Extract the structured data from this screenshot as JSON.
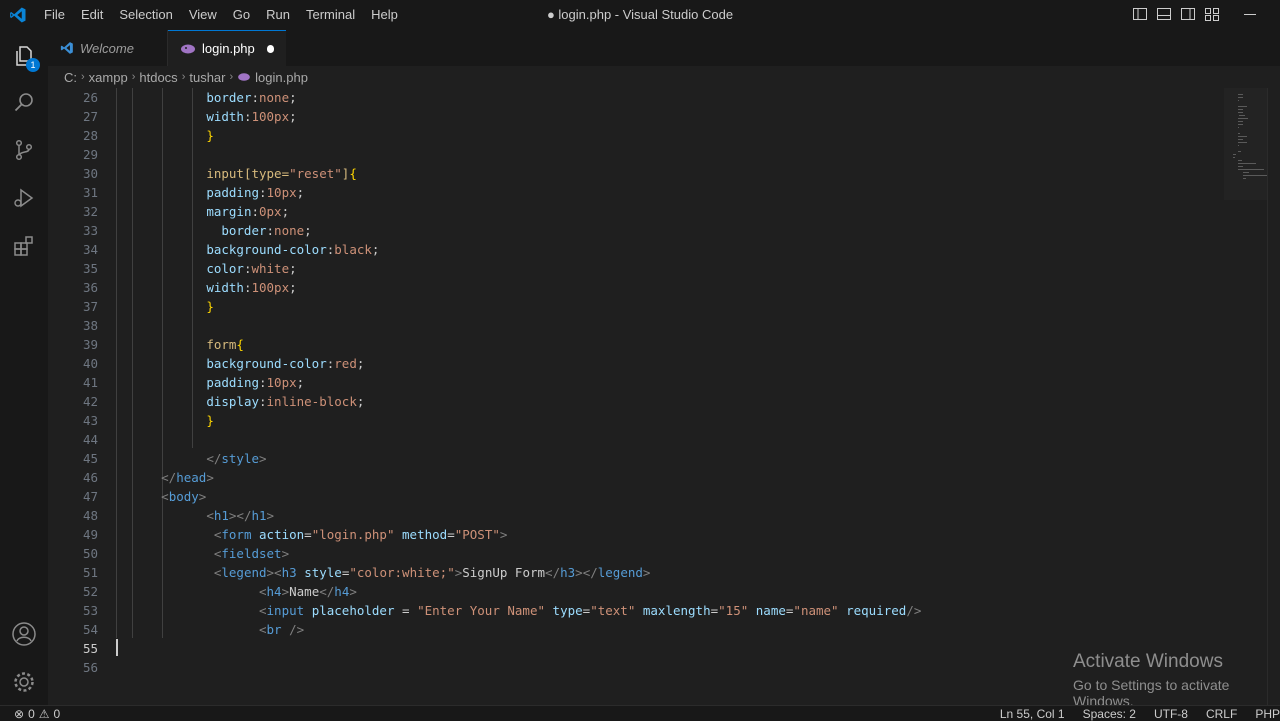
{
  "titlebar": {
    "menu": [
      "File",
      "Edit",
      "Selection",
      "View",
      "Go",
      "Run",
      "Terminal",
      "Help"
    ],
    "window_title": "● login.php - Visual Studio Code"
  },
  "activity": {
    "explorer_badge": "1",
    "icons": [
      "files-icon",
      "search-icon",
      "source-control-icon",
      "run-debug-icon",
      "extensions-icon",
      "account-icon",
      "settings-gear-icon"
    ]
  },
  "tabs": [
    {
      "label": "Welcome",
      "active": false
    },
    {
      "label": "login.php",
      "active": true,
      "modified": true
    }
  ],
  "breadcrumb": [
    "C:",
    "xampp",
    "htdocs",
    "tushar",
    "login.php"
  ],
  "editor": {
    "cursor_line": 55,
    "lines": [
      {
        "n": "26",
        "indent": "            ",
        "tokens": [
          [
            "prop",
            "border"
          ],
          [
            "punc",
            ":"
          ],
          [
            "val",
            "none"
          ],
          [
            "punc",
            ";"
          ]
        ]
      },
      {
        "n": "27",
        "indent": "            ",
        "tokens": [
          [
            "prop",
            "width"
          ],
          [
            "punc",
            ":"
          ],
          [
            "val",
            "100px"
          ],
          [
            "punc",
            ";"
          ]
        ]
      },
      {
        "n": "28",
        "indent": "            ",
        "tokens": [
          [
            "brace",
            "}"
          ]
        ]
      },
      {
        "n": "29",
        "indent": "",
        "tokens": []
      },
      {
        "n": "30",
        "indent": "            ",
        "tokens": [
          [
            "sel",
            "input[type="
          ],
          [
            "val",
            "\"reset\""
          ],
          [
            "sel",
            "]"
          ],
          [
            "brace",
            "{"
          ]
        ]
      },
      {
        "n": "31",
        "indent": "            ",
        "tokens": [
          [
            "prop",
            "padding"
          ],
          [
            "punc",
            ":"
          ],
          [
            "val",
            "10px"
          ],
          [
            "punc",
            ";"
          ]
        ]
      },
      {
        "n": "32",
        "indent": "            ",
        "tokens": [
          [
            "prop",
            "margin"
          ],
          [
            "punc",
            ":"
          ],
          [
            "val",
            "0px"
          ],
          [
            "punc",
            ";"
          ]
        ]
      },
      {
        "n": "33",
        "indent": "              ",
        "tokens": [
          [
            "prop",
            "border"
          ],
          [
            "punc",
            ":"
          ],
          [
            "val",
            "none"
          ],
          [
            "punc",
            ";"
          ]
        ]
      },
      {
        "n": "34",
        "indent": "            ",
        "tokens": [
          [
            "prop",
            "background-color"
          ],
          [
            "punc",
            ":"
          ],
          [
            "val",
            "black"
          ],
          [
            "punc",
            ";"
          ]
        ]
      },
      {
        "n": "35",
        "indent": "            ",
        "tokens": [
          [
            "prop",
            "color"
          ],
          [
            "punc",
            ":"
          ],
          [
            "val",
            "white"
          ],
          [
            "punc",
            ";"
          ]
        ]
      },
      {
        "n": "36",
        "indent": "            ",
        "tokens": [
          [
            "prop",
            "width"
          ],
          [
            "punc",
            ":"
          ],
          [
            "val",
            "100px"
          ],
          [
            "punc",
            ";"
          ]
        ]
      },
      {
        "n": "37",
        "indent": "            ",
        "tokens": [
          [
            "brace",
            "}"
          ]
        ]
      },
      {
        "n": "38",
        "indent": "",
        "tokens": []
      },
      {
        "n": "39",
        "indent": "            ",
        "tokens": [
          [
            "sel",
            "form"
          ],
          [
            "brace",
            "{"
          ]
        ]
      },
      {
        "n": "40",
        "indent": "            ",
        "tokens": [
          [
            "prop",
            "background-color"
          ],
          [
            "punc",
            ":"
          ],
          [
            "val",
            "red"
          ],
          [
            "punc",
            ";"
          ]
        ]
      },
      {
        "n": "41",
        "indent": "            ",
        "tokens": [
          [
            "prop",
            "padding"
          ],
          [
            "punc",
            ":"
          ],
          [
            "val",
            "10px"
          ],
          [
            "punc",
            ";"
          ]
        ]
      },
      {
        "n": "42",
        "indent": "            ",
        "tokens": [
          [
            "prop",
            "display"
          ],
          [
            "punc",
            ":"
          ],
          [
            "val",
            "inline-block"
          ],
          [
            "punc",
            ";"
          ]
        ]
      },
      {
        "n": "43",
        "indent": "            ",
        "tokens": [
          [
            "brace",
            "}"
          ]
        ]
      },
      {
        "n": "44",
        "indent": "",
        "tokens": []
      },
      {
        "n": "45",
        "indent": "            ",
        "tokens": [
          [
            "angle",
            "</"
          ],
          [
            "tag",
            "style"
          ],
          [
            "angle",
            ">"
          ]
        ]
      },
      {
        "n": "46",
        "indent": "      ",
        "tokens": [
          [
            "angle",
            "</"
          ],
          [
            "tag",
            "head"
          ],
          [
            "angle",
            ">"
          ]
        ]
      },
      {
        "n": "47",
        "indent": "      ",
        "tokens": [
          [
            "angle",
            "<"
          ],
          [
            "tag",
            "body"
          ],
          [
            "angle",
            ">"
          ]
        ]
      },
      {
        "n": "48",
        "indent": "            ",
        "tokens": [
          [
            "angle",
            "<"
          ],
          [
            "tag",
            "h1"
          ],
          [
            "angle",
            "></"
          ],
          [
            "tag",
            "h1"
          ],
          [
            "angle",
            ">"
          ]
        ]
      },
      {
        "n": "49",
        "indent": "             ",
        "tokens": [
          [
            "angle",
            "<"
          ],
          [
            "tag",
            "form"
          ],
          [
            "text",
            " "
          ],
          [
            "attr",
            "action"
          ],
          [
            "punc",
            "="
          ],
          [
            "str",
            "\"login.php\""
          ],
          [
            "text",
            " "
          ],
          [
            "attr",
            "method"
          ],
          [
            "punc",
            "="
          ],
          [
            "str",
            "\"POST\""
          ],
          [
            "angle",
            ">"
          ]
        ]
      },
      {
        "n": "50",
        "indent": "             ",
        "tokens": [
          [
            "angle",
            "<"
          ],
          [
            "tag",
            "fieldset"
          ],
          [
            "angle",
            ">"
          ]
        ]
      },
      {
        "n": "51",
        "indent": "             ",
        "tokens": [
          [
            "angle",
            "<"
          ],
          [
            "tag",
            "legend"
          ],
          [
            "angle",
            "><"
          ],
          [
            "tag",
            "h3"
          ],
          [
            "text",
            " "
          ],
          [
            "attr",
            "style"
          ],
          [
            "punc",
            "="
          ],
          [
            "str",
            "\"color:white;\""
          ],
          [
            "angle",
            ">"
          ],
          [
            "text",
            "SignUp Form"
          ],
          [
            "angle",
            "</"
          ],
          [
            "tag",
            "h3"
          ],
          [
            "angle",
            "></"
          ],
          [
            "tag",
            "legend"
          ],
          [
            "angle",
            ">"
          ]
        ]
      },
      {
        "n": "52",
        "indent": "                   ",
        "tokens": [
          [
            "angle",
            "<"
          ],
          [
            "tag",
            "h4"
          ],
          [
            "angle",
            ">"
          ],
          [
            "text",
            "Name"
          ],
          [
            "angle",
            "</"
          ],
          [
            "tag",
            "h4"
          ],
          [
            "angle",
            ">"
          ]
        ]
      },
      {
        "n": "53",
        "indent": "                   ",
        "tokens": [
          [
            "angle",
            "<"
          ],
          [
            "tag",
            "input"
          ],
          [
            "text",
            " "
          ],
          [
            "attr",
            "placeholder"
          ],
          [
            "text",
            " = "
          ],
          [
            "str",
            "\"Enter Your Name\""
          ],
          [
            "text",
            " "
          ],
          [
            "attr",
            "type"
          ],
          [
            "punc",
            "="
          ],
          [
            "str",
            "\"text\""
          ],
          [
            "text",
            " "
          ],
          [
            "attr",
            "maxlength"
          ],
          [
            "punc",
            "="
          ],
          [
            "str",
            "\"15\""
          ],
          [
            "text",
            " "
          ],
          [
            "attr",
            "name"
          ],
          [
            "punc",
            "="
          ],
          [
            "str",
            "\"name\""
          ],
          [
            "text",
            " "
          ],
          [
            "attr",
            "required"
          ],
          [
            "angle",
            "/>"
          ]
        ]
      },
      {
        "n": "54",
        "indent": "                   ",
        "tokens": [
          [
            "angle",
            "<"
          ],
          [
            "tag",
            "br"
          ],
          [
            "text",
            " "
          ],
          [
            "angle",
            "/>"
          ]
        ]
      },
      {
        "n": "55",
        "indent": "",
        "tokens": []
      },
      {
        "n": "56",
        "indent": "",
        "tokens": []
      }
    ]
  },
  "watermark": {
    "line1": "Activate Windows",
    "line2": "Go to Settings to activate Windows."
  },
  "statusbar": {
    "errors": "0",
    "warnings": "0",
    "position": "Ln 55, Col 1",
    "spaces": "Spaces: 2",
    "encoding": "UTF-8",
    "eol": "CRLF",
    "language": "PHP"
  }
}
